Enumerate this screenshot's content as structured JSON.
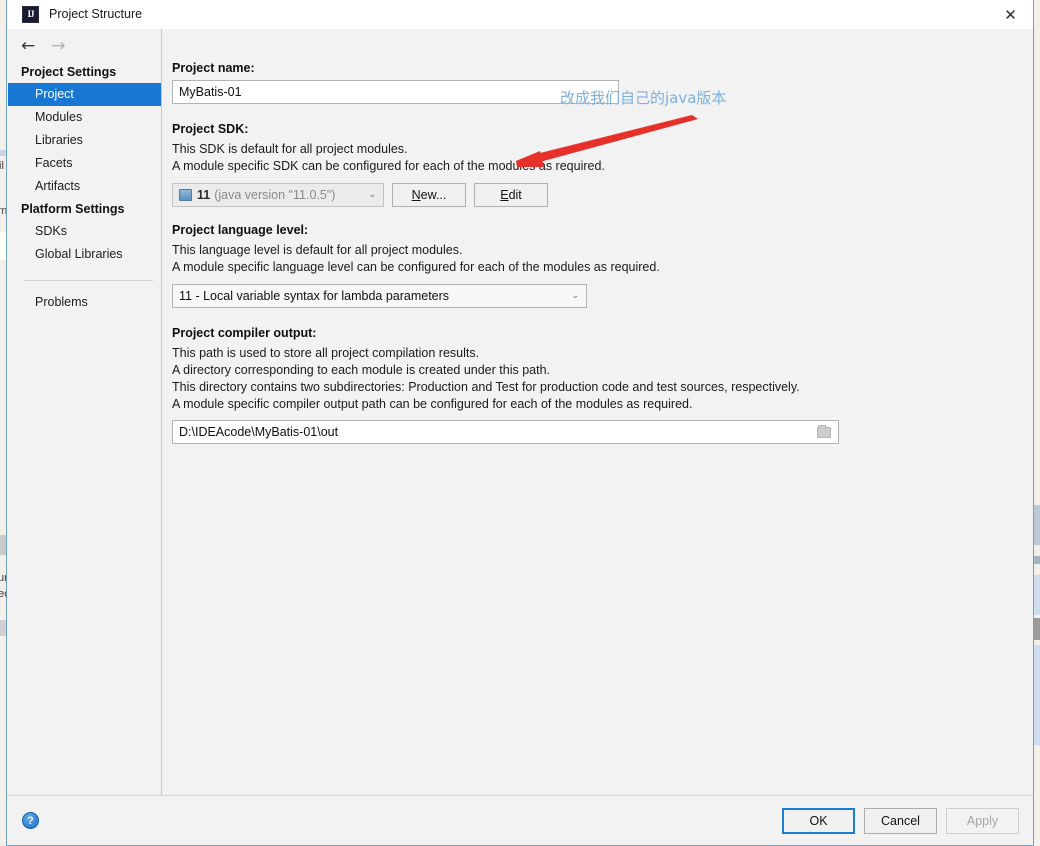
{
  "window": {
    "title": "Project Structure",
    "app_icon": "intellij-idea-icon",
    "close_label": "✕"
  },
  "nav": {
    "back": "←",
    "forward": "→"
  },
  "sidebar": {
    "groups": [
      {
        "header": "Project Settings",
        "items": [
          {
            "label": "Project",
            "selected": true
          },
          {
            "label": "Modules",
            "selected": false
          },
          {
            "label": "Libraries",
            "selected": false
          },
          {
            "label": "Facets",
            "selected": false
          },
          {
            "label": "Artifacts",
            "selected": false
          }
        ]
      },
      {
        "header": "Platform Settings",
        "items": [
          {
            "label": "SDKs",
            "selected": false
          },
          {
            "label": "Global Libraries",
            "selected": false
          }
        ]
      }
    ],
    "problems_label": "Problems"
  },
  "main": {
    "project_name": {
      "label": "Project name:",
      "value": "MyBatis-01"
    },
    "project_sdk": {
      "label": "Project SDK:",
      "desc_line_1": "This SDK is default for all project modules.",
      "desc_line_2": "A module specific SDK can be configured for each of the modules as required.",
      "selected_version": "11",
      "selected_detail": "(java version \"11.0.5\")",
      "caret": "⌄",
      "new_button": {
        "prefix": "",
        "mnemonic": "N",
        "suffix": "ew..."
      },
      "edit_button": {
        "prefix": "",
        "mnemonic": "E",
        "suffix": "dit"
      }
    },
    "language_level": {
      "label": "Project language level:",
      "desc_line_1": "This language level is default for all project modules.",
      "desc_line_2": "A module specific language level can be configured for each of the modules as required.",
      "selected": "11 - Local variable syntax for lambda parameters",
      "caret": "⌄"
    },
    "compiler_output": {
      "label": "Project compiler output:",
      "desc_line_1": "This path is used to store all project compilation results.",
      "desc_line_2": "A directory corresponding to each module is created under this path.",
      "desc_line_3": "This directory contains two subdirectories: Production and Test for production code and test sources, respectively.",
      "desc_line_4": "A module specific compiler output path can be configured for each of the modules as required.",
      "path": "D:\\IDEAcode\\MyBatis-01\\out",
      "browse_icon": "folder-icon"
    }
  },
  "annotation": {
    "text": "改成我们自己的java版本",
    "text_color": "#7eb0e0",
    "arrow_color": "#e8302a"
  },
  "footer": {
    "help_label": "?",
    "ok_label": "OK",
    "cancel_label": "Cancel",
    "apply_label": "Apply"
  },
  "colors": {
    "dialog_bg": "#f2f2f2",
    "selection_blue": "#1877d2",
    "border_blue": "#6ea2c9",
    "desktop_bg": "#f3efe9"
  }
}
